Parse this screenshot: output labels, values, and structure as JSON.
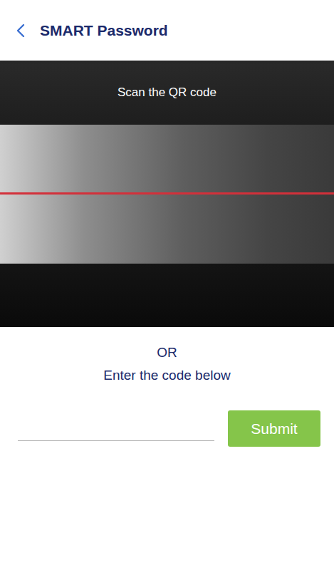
{
  "header": {
    "title": "SMART Password"
  },
  "scanner": {
    "prompt": "Scan the QR code"
  },
  "divider": "OR",
  "code_entry": {
    "label": "Enter the code below",
    "value": "",
    "button": "Submit"
  }
}
